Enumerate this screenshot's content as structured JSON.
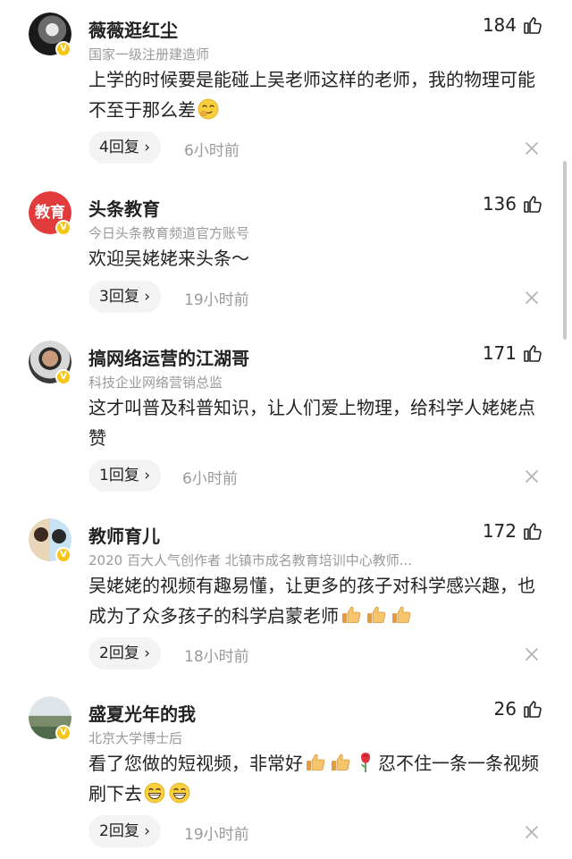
{
  "comments": [
    {
      "name": "薇薇逛红尘",
      "subtitle": "国家一级注册建造师",
      "likes": "184",
      "body": "上学的时候要是能碰上吴老师这样的老师，我的物理可能不至于那么差",
      "replies": "4回复",
      "time": "6小时前"
    },
    {
      "name": "头条教育",
      "subtitle": "今日头条教育频道官方账号",
      "likes": "136",
      "body": "欢迎吴姥姥来头条～",
      "replies": "3回复",
      "time": "19小时前",
      "avatar_text": "教育"
    },
    {
      "name": "搞网络运营的江湖哥",
      "subtitle": "科技企业网络营销总监",
      "likes": "171",
      "body": "这才叫普及科普知识，让人们爱上物理，给科学人姥姥点赞",
      "replies": "1回复",
      "time": "6小时前"
    },
    {
      "name": "教师育儿",
      "subtitle": "2020 百大人气创作者 北镇市成名教育培训中心教师...",
      "likes": "172",
      "body": "吴姥姥的视频有趣易懂，让更多的孩子对科学感兴趣，也成为了众多孩子的科学启蒙老师",
      "replies": "2回复",
      "time": "18小时前"
    },
    {
      "name": "盛夏光年的我",
      "subtitle": "北京大学博士后",
      "likes": "26",
      "body_a": "看了您做的短视频，非常好",
      "body_b": "忍不住一条一条视频刷下去",
      "replies": "2回复",
      "time": "19小时前"
    }
  ],
  "chevron": "›",
  "badge": "V",
  "colors": {
    "badge": "#f5c518",
    "edu_avatar": "#e23b3b",
    "muted": "#9a9a9a",
    "reply_bg": "#f3f3f3"
  }
}
